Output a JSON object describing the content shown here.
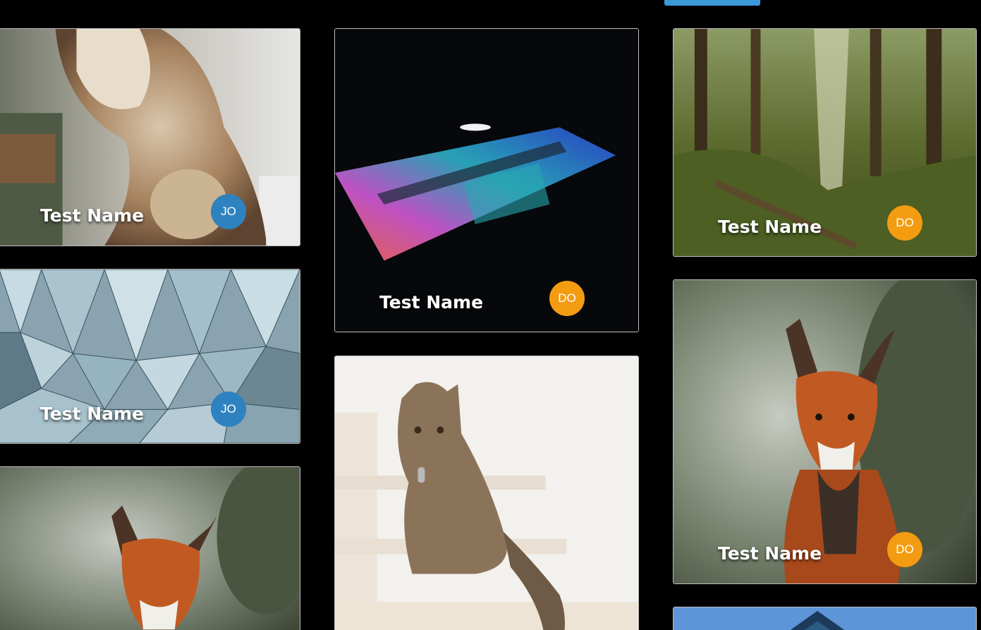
{
  "colors": {
    "background": "#000000",
    "top_button": "#3a9ad9",
    "avatar_blue": "#2f82c0",
    "avatar_orange": "#f39c12"
  },
  "cards": [
    {
      "subject": "siamese-cat",
      "name": "Test Name",
      "avatar": "JO",
      "avatar_color": "#2f82c0"
    },
    {
      "subject": "origami-pattern",
      "name": "Test Name",
      "avatar": "JO",
      "avatar_color": "#2f82c0"
    },
    {
      "subject": "red-fox",
      "name": "",
      "avatar": "",
      "avatar_color": ""
    },
    {
      "subject": "laptop",
      "name": "Test Name",
      "avatar": "DO",
      "avatar_color": "#f39c12"
    },
    {
      "subject": "tabby-cat-on-stairs",
      "name": "",
      "avatar": "",
      "avatar_color": ""
    },
    {
      "subject": "forest",
      "name": "Test Name",
      "avatar": "DO",
      "avatar_color": "#f39c12"
    },
    {
      "subject": "red-fox",
      "name": "Test Name",
      "avatar": "DO",
      "avatar_color": "#f39c12"
    },
    {
      "subject": "glass-building",
      "name": "",
      "avatar": "",
      "avatar_color": ""
    }
  ]
}
